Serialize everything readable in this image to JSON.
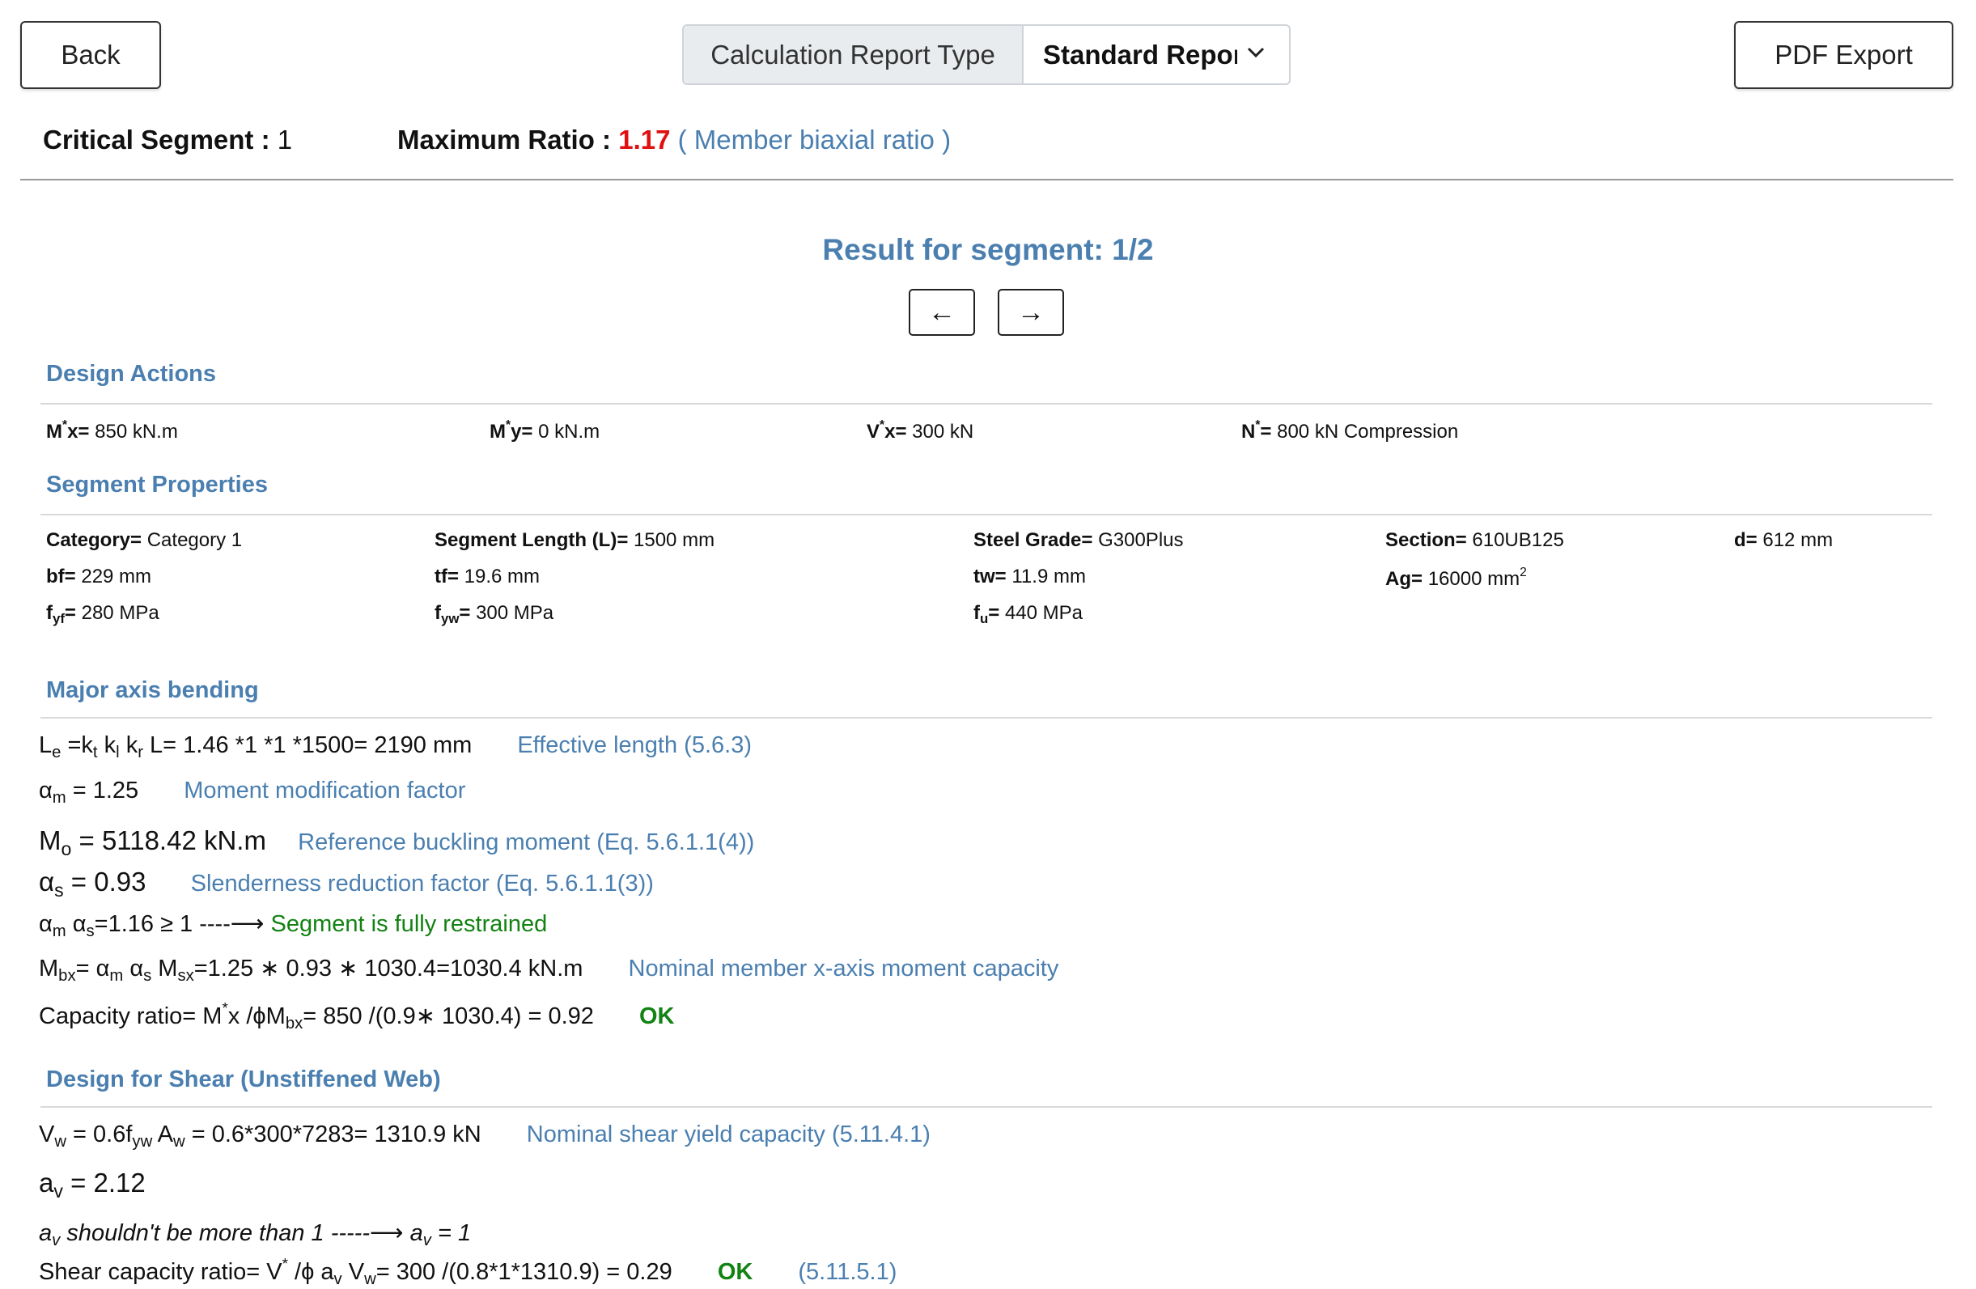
{
  "toolbar": {
    "back_label": "Back",
    "report_type_label": "Calculation Report Type",
    "report_type_value": "Standard Report",
    "pdf_label": "PDF Export"
  },
  "summary": {
    "critical_segment_label": "Critical Segment :",
    "critical_segment_value": "1",
    "max_ratio_label": "Maximum Ratio :",
    "max_ratio_value": "1.17",
    "max_ratio_note": "( Member biaxial ratio )"
  },
  "result": {
    "title": "Result for segment: 1/2",
    "prev_label": "←",
    "next_label": "→"
  },
  "design_actions": {
    "title": "Design Actions",
    "mx": "850 kN.m",
    "my": "0 kN.m",
    "vx": "300 kN",
    "n": "800 kN Compression"
  },
  "segment_properties": {
    "title": "Segment Properties",
    "category": "Category 1",
    "segment_length": "1500 mm",
    "steel_grade": "G300Plus",
    "section": "610UB125",
    "d": "612 mm",
    "bf": "229 mm",
    "tf": "19.6 mm",
    "tw": "11.9 mm",
    "ag": "16000 mm",
    "fyf": "280 MPa",
    "fyw": "300 MPa",
    "fu": "440 MPa"
  },
  "major_axis": {
    "title": "Major axis bending",
    "le_expr": "L= 1.46 *1 *1 *1500= 2190 mm",
    "le_note": "Effective length (5.6.3)",
    "am_expr": "= 1.25",
    "am_note": "Moment modification factor",
    "mo_expr": "= 5118.42 kN.m",
    "mo_note": "Reference buckling moment (Eq. 5.6.1.1(4))",
    "as_expr": "= 0.93",
    "as_note": "Slenderness reduction factor (Eq. 5.6.1.1(3))",
    "restrained_expr": "=1.16 ≥ 1 ----⟶",
    "restrained_note": "Segment is fully restrained",
    "mbx_expr": "=1.25 ∗ 0.93 ∗ 1030.4=1030.4 kN.m",
    "mbx_note": "Nominal member x-axis moment capacity",
    "ratio_expr_a": "Capacity ratio= M",
    "ratio_expr_b": "x /ϕM",
    "ratio_expr_c": "= 850 /(0.9∗ 1030.4) = 0.92",
    "ratio_status": "OK"
  },
  "shear": {
    "title": "Design for Shear (Unstiffened Web)",
    "vw_expr": "= 0.6*300*7283= 1310.9 kN",
    "vw_note": "Nominal shear yield capacity (5.11.4.1)",
    "av_expr": "= 2.12",
    "av_limit": "shouldn't be more than 1 -----⟶",
    "av_limit_result": "= 1",
    "ratio_expr_a": "Shear capacity ratio= V",
    "ratio_expr_b": "= 300 /(0.8*1*1310.9) = 0.29",
    "ratio_status": "OK",
    "ratio_ref": "(5.11.5.1)"
  }
}
